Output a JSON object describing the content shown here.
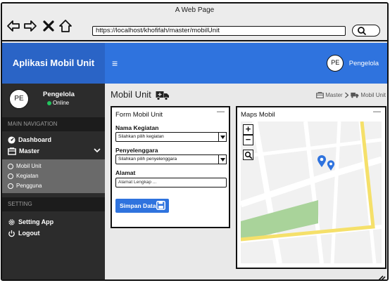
{
  "browser": {
    "title": "A Web Page",
    "url": "https://localhost/khofifah/master/mobilUnit"
  },
  "header": {
    "brand": "Aplikasi Mobil Unit",
    "hamburger": "≡",
    "user_initials": "PE",
    "user_name": "Pengelola"
  },
  "sidebar": {
    "profile": {
      "initials": "PE",
      "name": "Pengelola",
      "status": "Online"
    },
    "nav_section": "MAIN NAVIGATION",
    "items": [
      {
        "label": "Dashboard",
        "icon": "dashboard-icon"
      },
      {
        "label": "Master",
        "icon": "folder-icon"
      }
    ],
    "master_sub": [
      "Mobil Unit",
      "Kegiatan",
      "Pengguna"
    ],
    "setting_section": "SETTING",
    "setting_items": [
      {
        "label": "Setting App",
        "icon": "gear-icon"
      },
      {
        "label": "Logout",
        "icon": "power-icon"
      }
    ]
  },
  "main": {
    "page_title": "Mobil Unit",
    "breadcrumb": [
      "Master",
      "Mobil Unit"
    ],
    "form": {
      "title": "Form Mobil Unit",
      "minimize": "—",
      "kegiatan_label": "Nama Kegiatan",
      "kegiatan_placeholder": "Silahkan pilih kegiatan",
      "penyelenggara_label": "Penyelenggara",
      "penyelenggara_placeholder": "Silahkan pilih penyelenggara",
      "alamat_label": "Alamat",
      "alamat_placeholder": "Alamat Lengkap ...",
      "save_label": "Simpan Data"
    },
    "map": {
      "title": "Maps Mobil",
      "minimize": "—",
      "zoom_in": "+",
      "zoom_out": "−"
    }
  },
  "colors": {
    "header_blue": "#2f73de",
    "brand_blue": "#2a64c6",
    "sidebar_dark": "#2c2c2c",
    "online_green": "#22c55e",
    "map_pin": "#2f73de",
    "park_green": "#a9d39a",
    "road_yellow": "#f5e06a"
  }
}
